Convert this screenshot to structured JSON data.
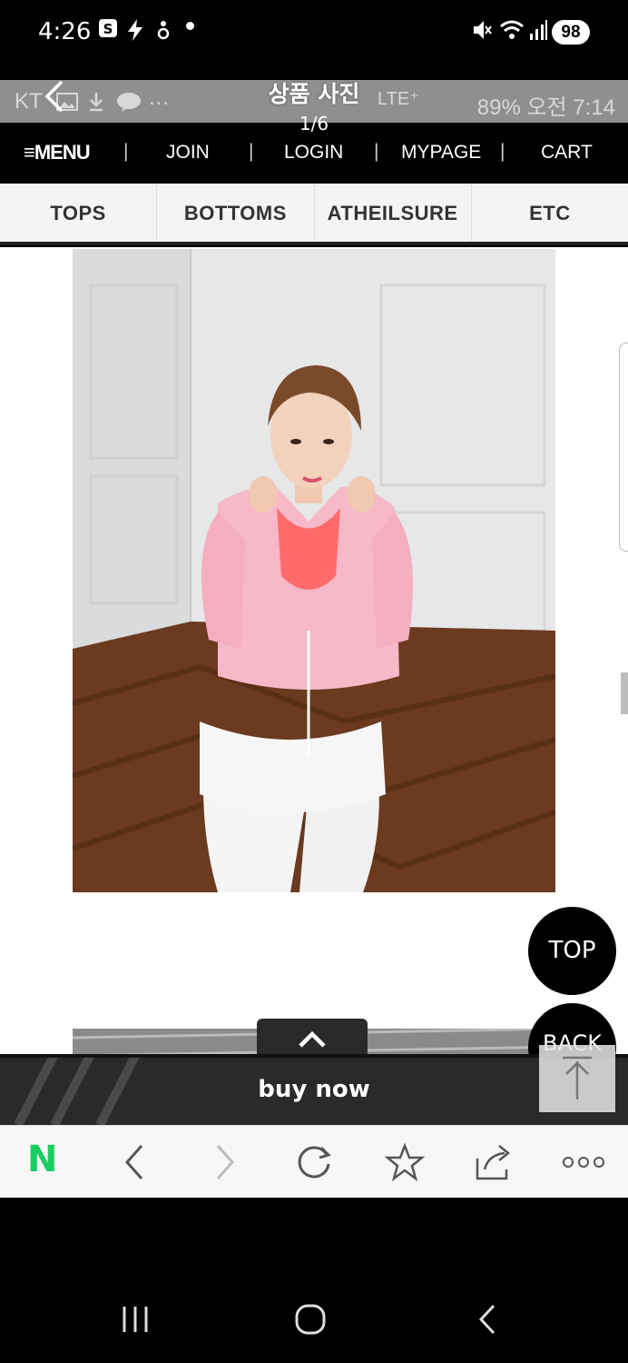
{
  "status_bar": {
    "time": "4:26",
    "battery": "98"
  },
  "inner_status": {
    "carrier": "KT",
    "lte": "LTE⁺",
    "right": "89%  오전 7:14"
  },
  "viewer": {
    "title": "상품 사진",
    "counter": "1/6"
  },
  "topnav": {
    "menu": "≡MENU",
    "join": "JOIN",
    "login": "LOGIN",
    "mypage": "MYPAGE",
    "cart": "CART",
    "sep": "|"
  },
  "categories": [
    "TOPS",
    "BOTTOMS",
    "ATHEILSURE",
    "ETC"
  ],
  "buttons": {
    "top": "TOP",
    "back": "BACK",
    "buy_now": "buy now"
  },
  "browser": {
    "logo": "N"
  },
  "colors": {
    "naver_green": "#19ce60",
    "jacket_pink": "#f7b8c9",
    "floor_wood": "#6b3a1f"
  }
}
